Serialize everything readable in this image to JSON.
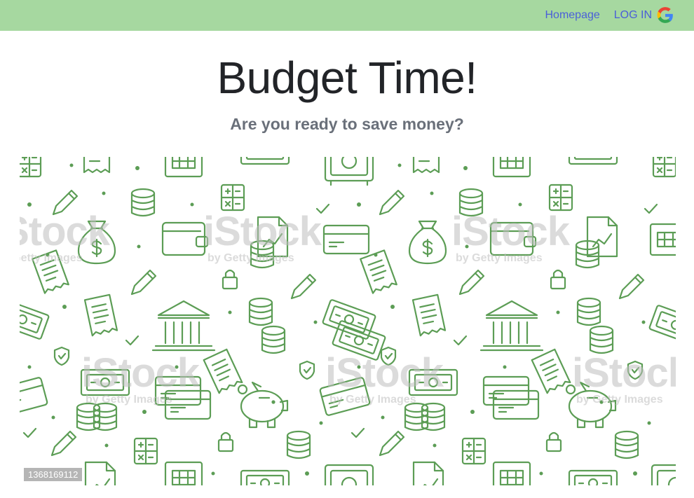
{
  "nav": {
    "homepage_label": "Homepage",
    "login_label": "LOG IN",
    "login_icon": "google-g-icon"
  },
  "hero": {
    "title": "Budget Time!",
    "subtitle": "Are you ready to save money?"
  },
  "image": {
    "watermark_brand": "iStock",
    "watermark_credit": "by Getty Images",
    "stock_id": "1368169112",
    "icon_color": "#5c9d55",
    "icons": [
      "money-bag-icon",
      "wallet-icon",
      "bank-icon",
      "piggy-bank-icon",
      "banknote-icon",
      "credit-card-icon",
      "coin-stack-icon",
      "calculator-icon",
      "receipt-icon",
      "pencil-icon",
      "padlock-icon",
      "shield-check-icon",
      "safe-icon",
      "document-chart-icon",
      "checkmark-icon"
    ]
  },
  "colors": {
    "topbar": "#a6d8a0",
    "nav_link": "#4a5fd8",
    "title": "#222428",
    "subtitle": "#6a707a"
  }
}
